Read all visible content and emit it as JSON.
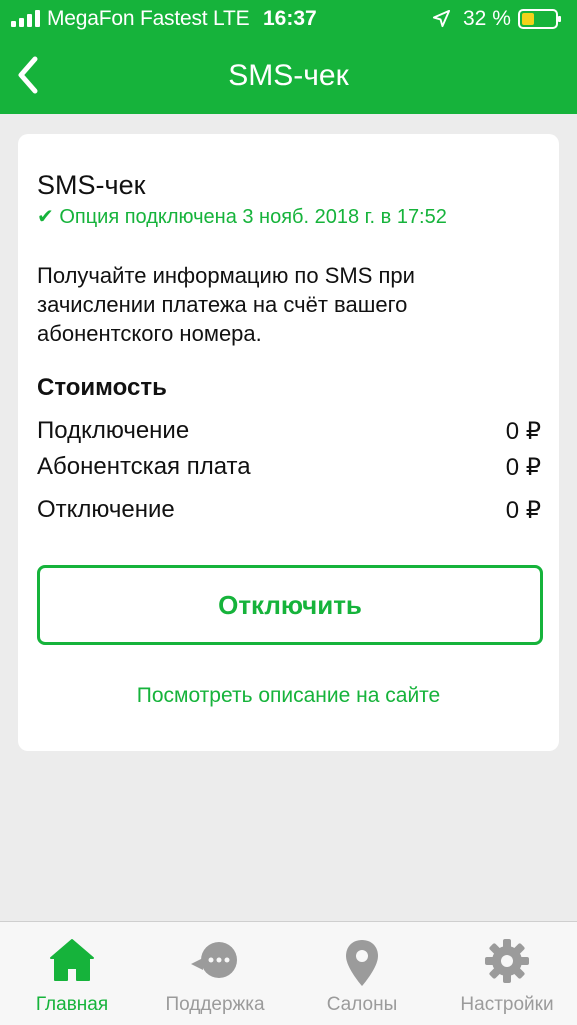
{
  "status_bar": {
    "carrier": "MegaFon Fastest  LTE",
    "time": "16:37",
    "battery": "32 %"
  },
  "nav": {
    "title": "SMS-чек"
  },
  "option": {
    "title": "SMS-чек",
    "status": "✔ Опция подключена 3 нояб. 2018 г. в 17:52",
    "description": "Получайте информацию по SMS при зачислении платежа на счёт вашего абонентского номера.",
    "cost_heading": "Стоимость",
    "costs": [
      {
        "label": "Подключение",
        "value": "0 ₽"
      },
      {
        "label": "Абонентская плата",
        "value": "0 ₽"
      },
      {
        "label": "Отключение",
        "value": "0 ₽"
      }
    ],
    "disconnect_label": "Отключить",
    "site_link": "Посмотреть описание на сайте"
  },
  "tabs": [
    {
      "label": "Главная",
      "icon": "home-icon",
      "active": true
    },
    {
      "label": "Поддержка",
      "icon": "chat-icon",
      "active": false
    },
    {
      "label": "Салоны",
      "icon": "map-pin-icon",
      "active": false
    },
    {
      "label": "Настройки",
      "icon": "gear-icon",
      "active": false
    }
  ],
  "colors": {
    "accent": "#16b33b",
    "background": "#ececec",
    "inactive_tab": "#9b9b9b"
  }
}
